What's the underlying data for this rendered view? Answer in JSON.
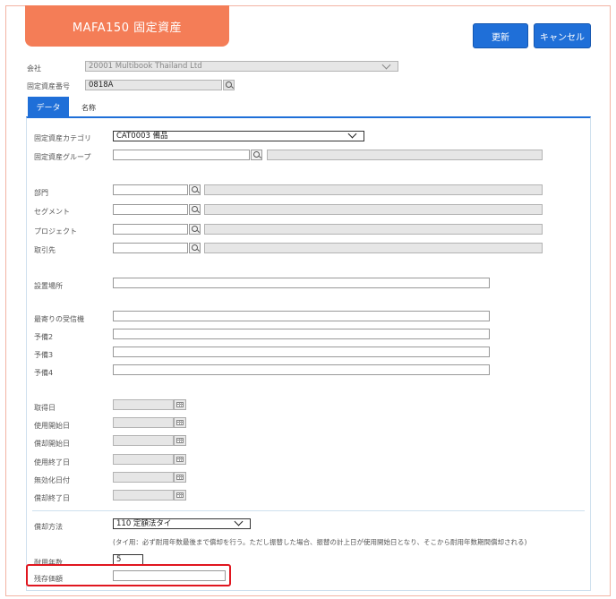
{
  "header": {
    "title": "MAFA150 固定資産",
    "update_label": "更新",
    "cancel_label": "キャンセル"
  },
  "top": {
    "company_label": "会社",
    "company_value": "20001 Multibook Thailand Ltd",
    "asset_number_label": "固定資産番号",
    "asset_number_value": "0818A"
  },
  "tabs": [
    {
      "label": "データ",
      "active": true
    },
    {
      "label": "名称",
      "active": false
    }
  ],
  "form": {
    "category_label": "固定資産カテゴリ",
    "category_value": "CAT0003 備品",
    "group_label": "固定資産グループ",
    "department_label": "部門",
    "segment_label": "セグメント",
    "project_label": "プロジェクト",
    "partner_label": "取引先",
    "location_label": "設置場所",
    "nearest_receiver_label": "最寄りの受信機",
    "reserve2_label": "予備2",
    "reserve3_label": "予備3",
    "reserve4_label": "予備4",
    "acquisition_date_label": "取得日",
    "use_start_date_label": "使用開始日",
    "depr_start_date_label": "償却開始日",
    "use_end_date_label": "使用終了日",
    "invalidation_date_label": "無効化日付",
    "depr_end_date_label": "償却終了日",
    "depr_method_label": "償却方法",
    "depr_method_value": "110 定額法タイ",
    "depr_method_note": "(タイ用：必ず耐用年数最後まで償却を行う。ただし振替した場合、振替の計上日が使用開始日となり、そこから耐用年数期間償却される)",
    "useful_life_label": "耐用年数",
    "useful_life_value": "5",
    "residual_value_label": "残存価額",
    "residual_value_value": ""
  },
  "colors": {
    "accent": "#1f6fd8",
    "title_bg": "#f47d57",
    "highlight": "#e0161f"
  }
}
